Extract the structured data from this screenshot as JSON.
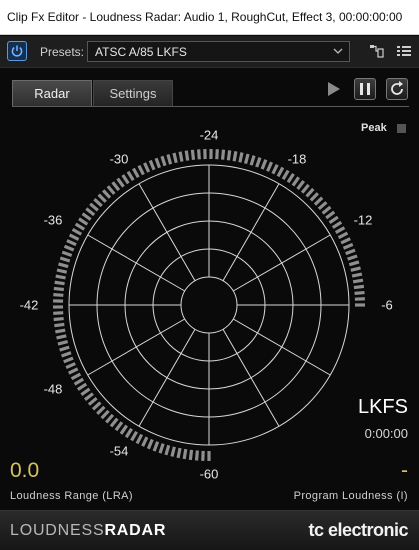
{
  "window": {
    "title": "Clip Fx Editor - Loudness Radar: Audio 1, RoughCut, Effect 3, 00:00:00:00"
  },
  "toolbar": {
    "presets_label": "Presets:",
    "preset_value": "ATSC A/85 LKFS",
    "icons": [
      "power-icon",
      "chevron-down-icon",
      "routing-icon",
      "menu-icon"
    ]
  },
  "tabs": [
    {
      "label": "Radar",
      "active": true
    },
    {
      "label": "Settings",
      "active": false
    }
  ],
  "transport": {
    "icons": [
      "play-icon",
      "pause-icon",
      "reset-icon"
    ]
  },
  "radar": {
    "scale_labels": [
      "-24",
      "-18",
      "-12",
      "-6",
      "-60",
      "-54",
      "-48",
      "-42",
      "-36",
      "-30"
    ],
    "peak_label": "Peak",
    "unit": "LKFS",
    "time": "0:00:00",
    "lra_value": "0.0",
    "lra_label": "Loudness Range (LRA)",
    "program_value": "-",
    "program_label": "Program Loudness (I)"
  },
  "footer": {
    "brand_left_light": "LOUDNESS",
    "brand_left_bold": "RADAR",
    "brand_right": "tc electronic"
  },
  "colors": {
    "accent_blue": "#5a9be0",
    "value_yellow": "#d6c263",
    "background": "#0a0a0a"
  }
}
